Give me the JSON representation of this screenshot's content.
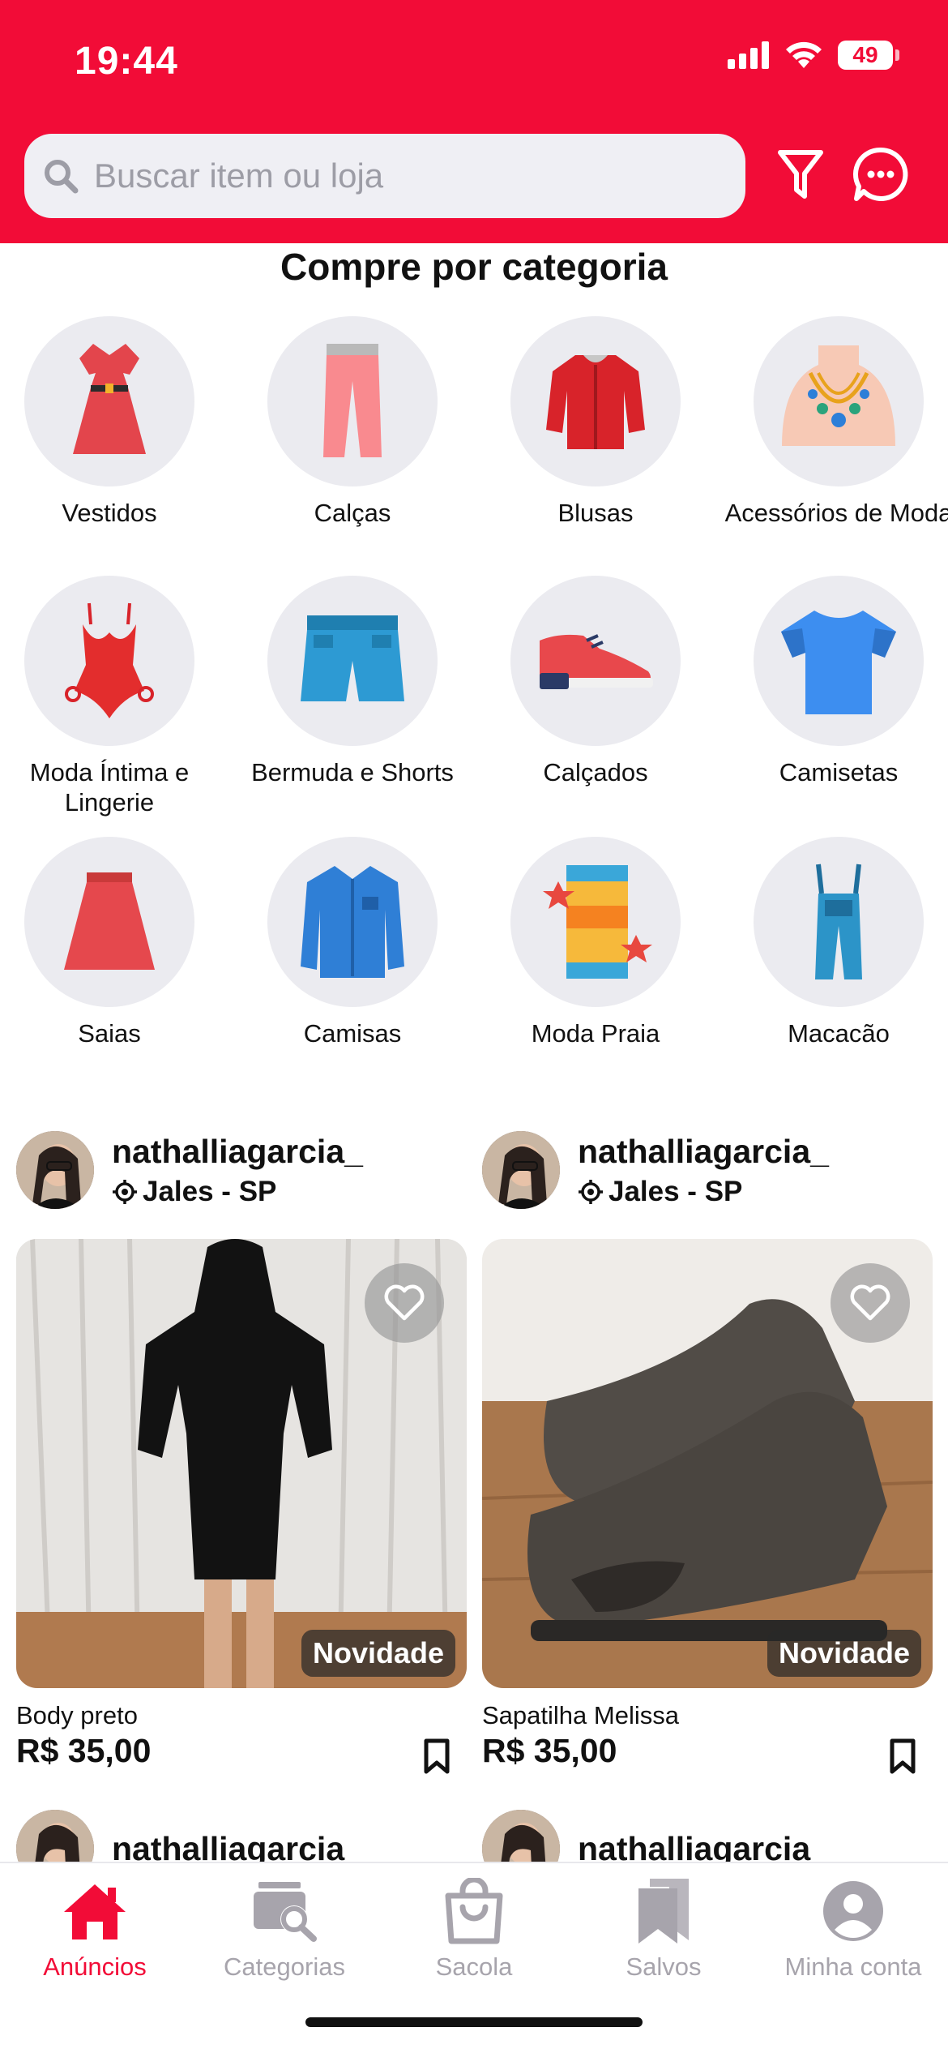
{
  "status_bar": {
    "time": "19:44",
    "battery": "49"
  },
  "search": {
    "placeholder": "Buscar item ou loja"
  },
  "categories_section": {
    "title": "Compre por categoria",
    "items": [
      {
        "label": "Vestidos",
        "icon": "dress-icon"
      },
      {
        "label": "Calças",
        "icon": "pants-icon"
      },
      {
        "label": "Blusas",
        "icon": "blouse-icon"
      },
      {
        "label": "Acessórios de Moda",
        "icon": "necklace-icon"
      },
      {
        "label": "Moda Íntima e Lingerie",
        "icon": "lingerie-icon"
      },
      {
        "label": "Bermuda e Shorts",
        "icon": "shorts-icon"
      },
      {
        "label": "Calçados",
        "icon": "sneaker-icon"
      },
      {
        "label": "Camisetas",
        "icon": "tshirt-icon"
      },
      {
        "label": "Saias",
        "icon": "skirt-icon"
      },
      {
        "label": "Camisas",
        "icon": "shirt-icon"
      },
      {
        "label": "Moda Praia",
        "icon": "beach-towel-icon"
      },
      {
        "label": "Macacão",
        "icon": "overalls-icon"
      }
    ]
  },
  "products": [
    {
      "seller": "nathalliagarcia_",
      "location": "Jales - SP",
      "badge": "Novidade",
      "title": "Body preto",
      "price": "R$ 35,00"
    },
    {
      "seller": "nathalliagarcia_",
      "location": "Jales - SP",
      "badge": "Novidade",
      "title": "Sapatilha Melissa",
      "price": "R$ 35,00"
    },
    {
      "seller": "nathalliagarcia_"
    },
    {
      "seller": "nathalliagarcia_"
    }
  ],
  "bottom_nav": [
    {
      "label": "Anúncios",
      "icon": "home-icon",
      "active": true
    },
    {
      "label": "Categorias",
      "icon": "categories-search-icon",
      "active": false
    },
    {
      "label": "Sacola",
      "icon": "bag-icon",
      "active": false
    },
    {
      "label": "Salvos",
      "icon": "bookmarks-icon",
      "active": false
    },
    {
      "label": "Minha conta",
      "icon": "account-icon",
      "active": false
    }
  ],
  "colors": {
    "brand": "#f20c37",
    "nav_inactive": "#a7a4ac",
    "circle_bg": "#ebebf0"
  }
}
